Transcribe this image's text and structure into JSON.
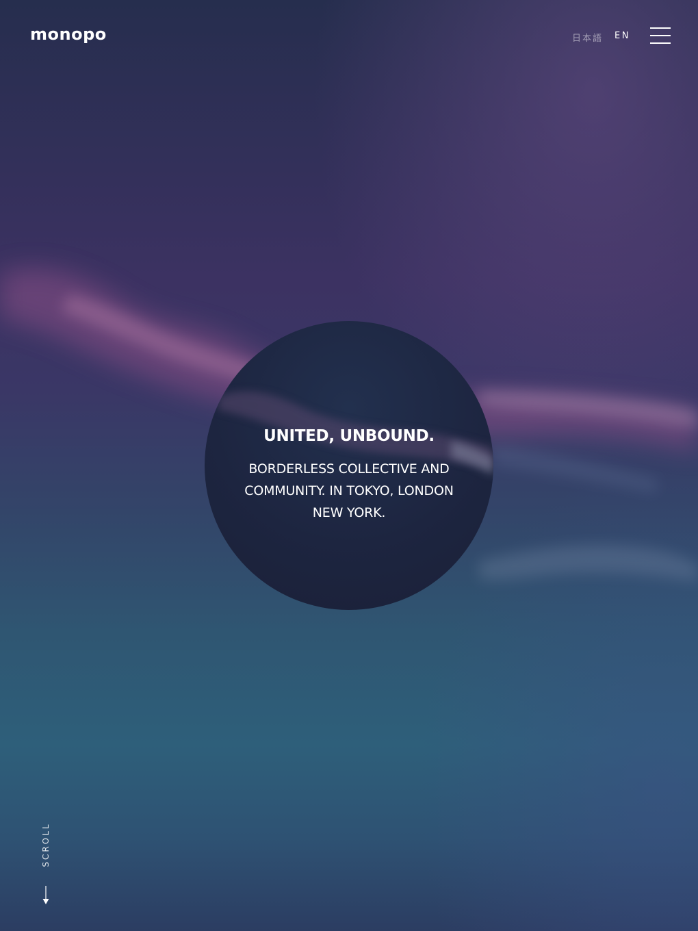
{
  "header": {
    "logo": "monopo",
    "lang_ja": "日本語",
    "lang_en": "EN",
    "menu_icon": "hamburger-menu-icon"
  },
  "hero": {
    "headline": "UNITED, UNBOUND.",
    "subtext_line1": "BORDERLESS COLLECTIVE AND",
    "subtext_line2": "COMMUNITY. IN TOKYO, LONDON",
    "subtext_line3": "NEW YORK."
  },
  "scroll": {
    "label": "SCROLL",
    "icon": "arrow-down-icon"
  },
  "colors": {
    "sky_top": "#262e4e",
    "sky_mid": "#3c3262",
    "sky_bottom": "#2e5f7a",
    "circle": "#1d2540",
    "text": "#ffffff"
  }
}
